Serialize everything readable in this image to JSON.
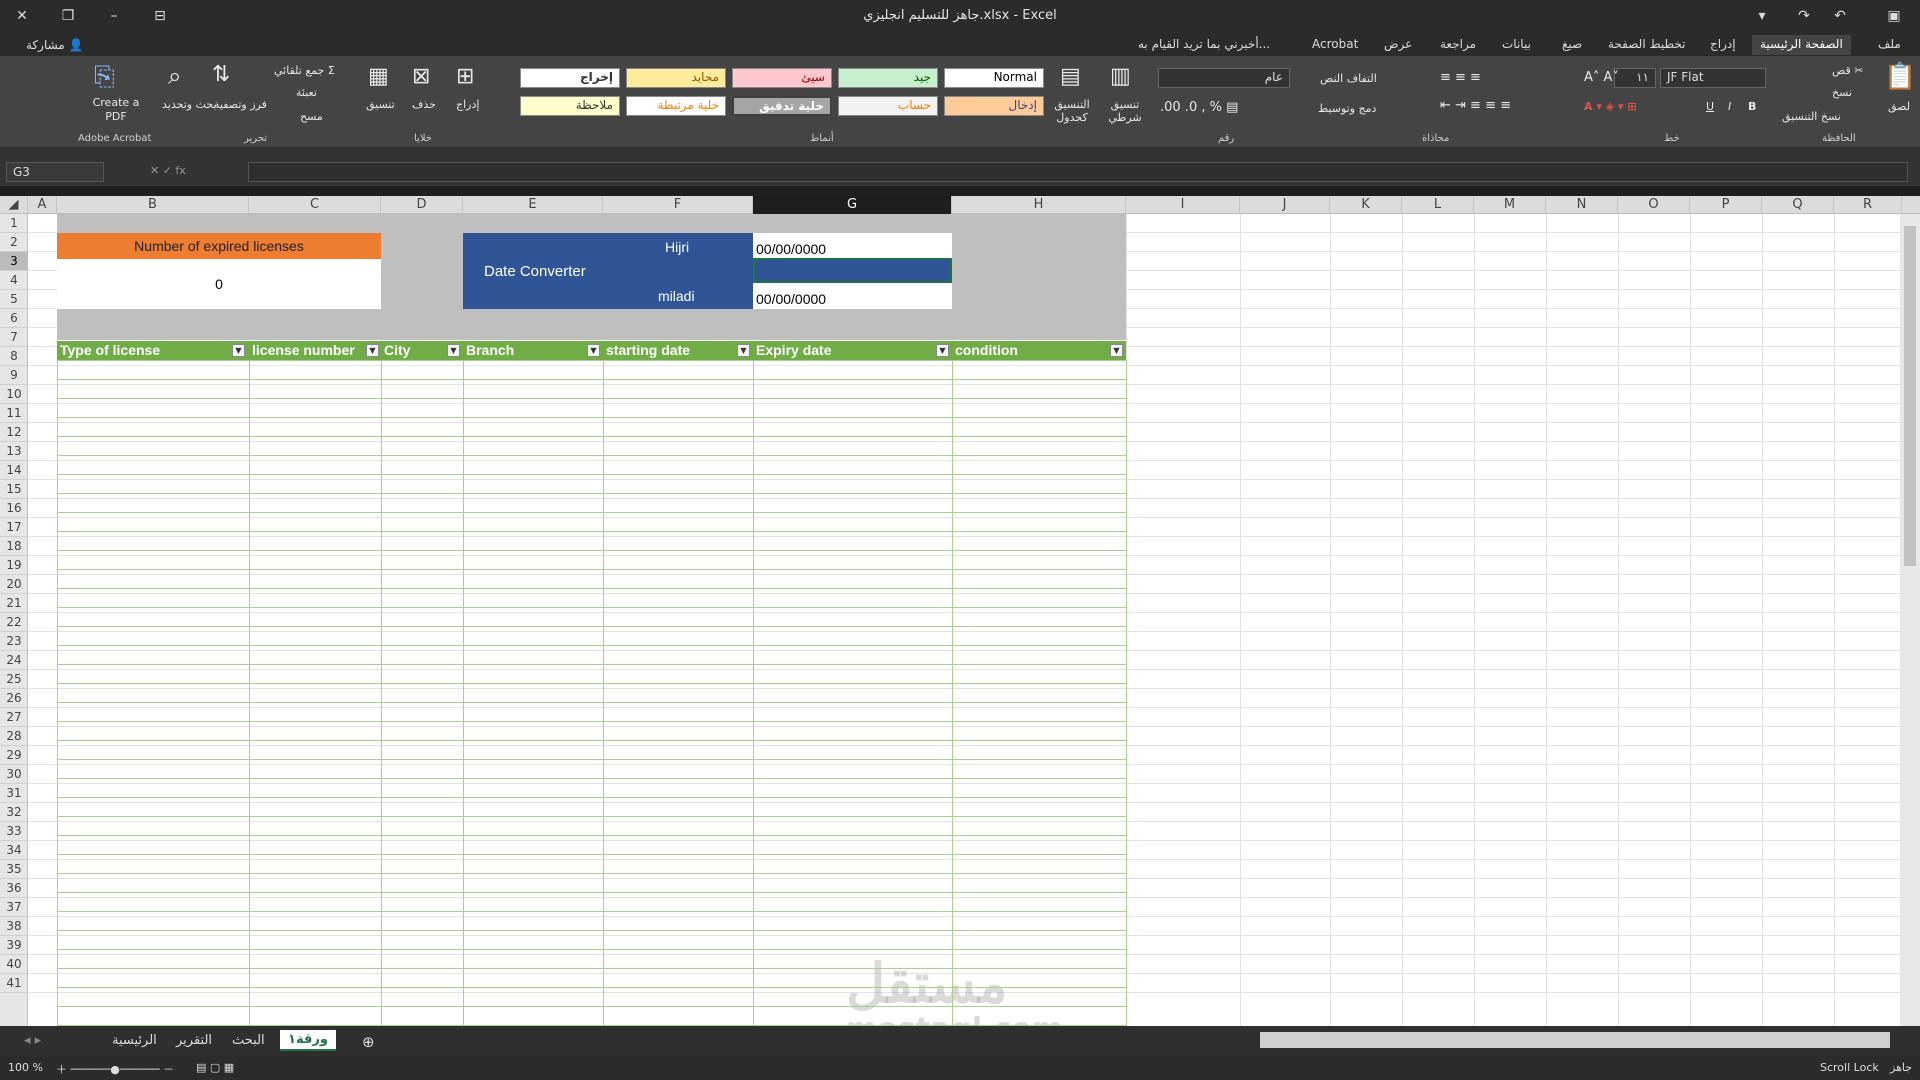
{
  "window": {
    "title": "جاهز للتسليم انجليزي.xlsx - Excel",
    "share": "مشاركة"
  },
  "tabs": [
    "ملف",
    "الصفحة الرئيسية",
    "إدراج",
    "تخطيط الصفحة",
    "صيغ",
    "بيانات",
    "مراجعة",
    "عرض",
    "Acrobat"
  ],
  "tell_me": "أخبرني بما تريد القيام به...",
  "ribbon": {
    "clipboard": {
      "paste": "لصق",
      "cut": "قص",
      "copy": "نسخ",
      "format_painter": "نسخ التنسيق",
      "group": "الحافظة"
    },
    "font": {
      "name": "JF Flat",
      "size": "١١",
      "group": "خط",
      "bold": "B",
      "italic": "I",
      "underline": "U"
    },
    "alignment": {
      "wrap": "التفاف النص",
      "merge": "دمج وتوسيط",
      "group": "محاذاة"
    },
    "number": {
      "format": "عام",
      "group": "رقم"
    },
    "styles": {
      "conditional": "تنسيق شرطي",
      "as_table": "التنسيق كجدول",
      "normal": "Normal",
      "good": "جيد",
      "bad": "سيئ",
      "neutral": "محايد",
      "output": "إخراج",
      "input": "إدخال",
      "calculation": "حساب",
      "check_cell": "خلية تدقيق",
      "linked_cell": "خلية مرتبطة",
      "note": "ملاحظة",
      "group": "أنماط"
    },
    "cells": {
      "insert": "إدراج",
      "delete": "حذف",
      "format": "تنسيق",
      "group": "خلايا"
    },
    "editing": {
      "autosum": "جمع تلقائي",
      "fill": "تعبئة",
      "clear": "مسح",
      "sort": "فرز وتصفية",
      "find": "بحث وتحديد",
      "group": "تحرير"
    },
    "acrobat": {
      "create": "Create a PDF",
      "group": "Adobe Acrobat"
    }
  },
  "name_box": "G3",
  "columns": [
    "A",
    "B",
    "C",
    "D",
    "E",
    "F",
    "G",
    "H",
    "I",
    "J",
    "K",
    "L",
    "M",
    "N",
    "O",
    "P",
    "Q",
    "R"
  ],
  "rows": [
    "1",
    "2",
    "3",
    "4",
    "5",
    "6",
    "7",
    "8",
    "9",
    "10",
    "11",
    "12",
    "13",
    "14",
    "15",
    "16",
    "17",
    "18",
    "19",
    "20",
    "21",
    "22",
    "23",
    "24",
    "25",
    "26",
    "27",
    "28",
    "29",
    "30",
    "31",
    "32",
    "33",
    "34",
    "35",
    "36",
    "37",
    "38",
    "39",
    "40",
    "41"
  ],
  "dashboard": {
    "expired_label": "Number of expired licenses",
    "expired_value": "0",
    "converter_title": "Date Converter",
    "hijri_label": "Hijri",
    "miladi_label": "miladi",
    "hijri_value": "00/00/0000",
    "miladi_value": "00/00/0000"
  },
  "table": {
    "headers": [
      "Type of license",
      "license number",
      "City",
      "Branch",
      "starting date",
      "Expiry date",
      "condition"
    ]
  },
  "sheet_tabs": [
    "الرئيسية",
    "التقرير",
    "البحث",
    "ورقة١"
  ],
  "status": {
    "ready": "جاهز",
    "scroll_lock": "Scroll Lock",
    "zoom": "100 %"
  },
  "watermark": {
    "text1": "مستقل",
    "text2": "mostaql.com"
  },
  "colors": {
    "orange": "#ed7d31",
    "navy": "#2f5597",
    "green": "#70ad47",
    "ribbon": "#444444"
  }
}
